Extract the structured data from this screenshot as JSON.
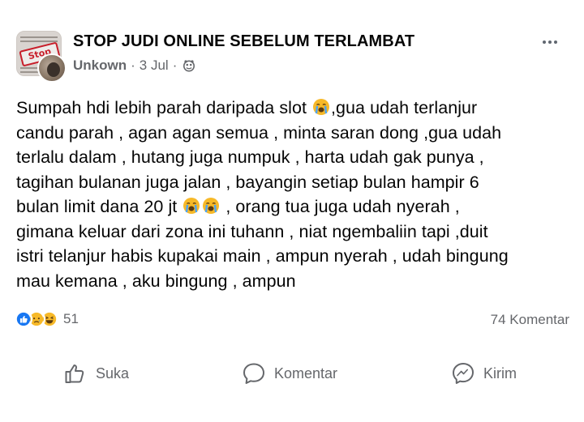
{
  "post": {
    "group_name": "STOP JUDI ONLINE SEBELUM TERLAMBAT",
    "author": "Unkown",
    "separator": "·",
    "date": "3 Jul",
    "audience_icon": "group-audience-icon",
    "avatar_stamp": "Stop",
    "body_lines": [
      [
        "Sumpah hdi lebih parah daripada slot ",
        ",gua udah terlanjur"
      ],
      [
        "candu parah , agan agan semua , minta saran dong ,gua udah"
      ],
      [
        "terlalu dalam , hutang juga numpuk , harta udah gak punya ,"
      ],
      [
        "tagihan bulanan juga  jalan , bayangin setiap bulan hampir 6"
      ],
      [
        "bulan limit dana 20 jt ",
        " , orang tua juga udah nyerah ,"
      ],
      [
        "gimana keluar dari zona ini tuhann ,  niat ngembaliin tapi  ,duit"
      ],
      [
        "istri telanjur habis kupakai main , ampun nyerah , udah bingung"
      ],
      [
        "mau kemana , aku bingung , ampun"
      ]
    ],
    "body_emoji": "loudly-crying-face"
  },
  "stats": {
    "reactions": [
      "like",
      "sad",
      "haha"
    ],
    "reaction_count": "51",
    "comments": "74 Komentar"
  },
  "actions": {
    "like_label": "Suka",
    "comment_label": "Komentar",
    "send_label": "Kirim"
  },
  "colors": {
    "text": "#050505",
    "secondary": "#65676b",
    "like_blue": "#1877f2",
    "emoji_yellow": "#f7b928",
    "stamp_red": "#c81e2a"
  }
}
